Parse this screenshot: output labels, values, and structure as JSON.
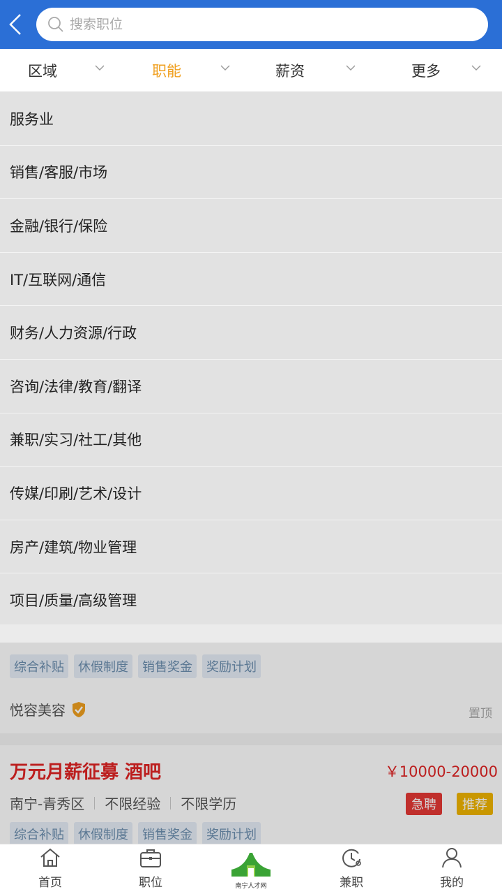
{
  "search": {
    "placeholder": "搜索职位"
  },
  "filters": [
    {
      "label": "区域",
      "active": false
    },
    {
      "label": "职能",
      "active": true
    },
    {
      "label": "薪资",
      "active": false
    },
    {
      "label": "更多",
      "active": false
    }
  ],
  "dropdown": {
    "items": [
      "服务业",
      "销售/客服/市场",
      "金融/银行/保险",
      "IT/互联网/通信",
      "财务/人力资源/行政",
      "咨询/法律/教育/翻译",
      "兼职/实习/社工/其他",
      "传媒/印刷/艺术/设计",
      "房产/建筑/物业管理",
      "项目/质量/高级管理"
    ]
  },
  "job1": {
    "tags": [
      "综合补贴",
      "休假制度",
      "销售奖金",
      "奖励计划"
    ],
    "company": "悦容美容",
    "pinned": "置顶"
  },
  "job2": {
    "title": "万元月薪征募 酒吧",
    "salary": "￥10000-20000",
    "location": "南宁-青秀区",
    "experience": "不限经验",
    "education": "不限学历",
    "badge_urgent": "急聘",
    "badge_recommend": "推荐",
    "tags": [
      "综合补贴",
      "休假制度",
      "销售奖金",
      "奖励计划"
    ]
  },
  "nav": {
    "home": "首页",
    "jobs": "职位",
    "logo_text": "南宁人才网",
    "parttime": "兼职",
    "mine": "我的"
  },
  "colors": {
    "header": "#2b6fd6",
    "active_filter": "#f0a020",
    "title_red": "#e02424",
    "badge_urgent": "#e53935",
    "badge_recommend": "#f0b400"
  }
}
